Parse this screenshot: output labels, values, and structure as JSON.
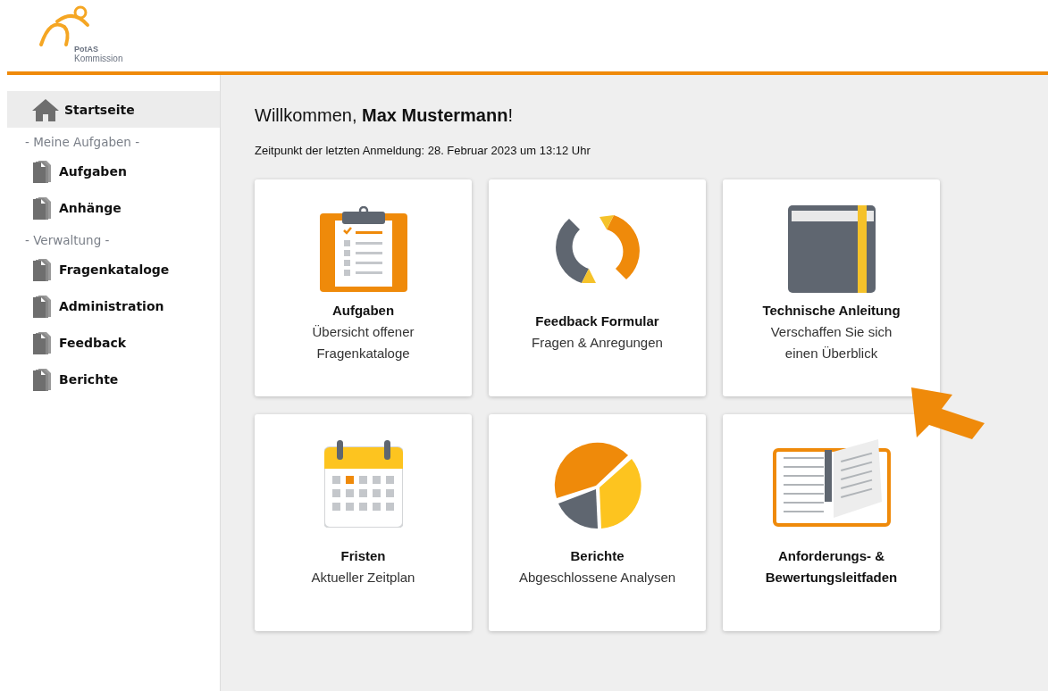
{
  "logo": {
    "name": "PotAS",
    "subtitle": "Kommission"
  },
  "sidebar": {
    "items": [
      {
        "kind": "home",
        "label": "Startseite",
        "selected": true
      },
      {
        "kind": "section",
        "label": "- Meine Aufgaben -"
      },
      {
        "kind": "page",
        "label": "Aufgaben",
        "selected": false
      },
      {
        "kind": "page",
        "label": "Anhänge",
        "selected": false
      },
      {
        "kind": "section",
        "label": "- Verwaltung -"
      },
      {
        "kind": "page",
        "label": "Fragenkataloge",
        "selected": false
      },
      {
        "kind": "page",
        "label": "Administration",
        "selected": false
      },
      {
        "kind": "page",
        "label": "Feedback",
        "selected": false
      },
      {
        "kind": "page",
        "label": "Berichte",
        "selected": false
      }
    ]
  },
  "main": {
    "greeting": "Willkommen, **Max Mustermann**!",
    "last_login": "Zeitpunkt der letzten Anmeldung: 28. Februar 2023 um 13:12 Uhr",
    "tiles": [
      {
        "kind": "clipboard",
        "title": "Aufgaben",
        "subtitle_lines": [
          "Übersicht offener",
          "Fragenkataloge"
        ]
      },
      {
        "kind": "pencils",
        "title": "Feedback Formular",
        "subtitle_lines": [
          "Fragen & Anregungen"
        ]
      },
      {
        "kind": "book",
        "title": "Technische Anleitung",
        "subtitle_lines": [
          "Verschaffen Sie sich",
          "einen Überblick"
        ]
      },
      {
        "kind": "calendar",
        "title": "Fristen",
        "subtitle_lines": [
          "Aktueller Zeitplan"
        ]
      },
      {
        "kind": "pie",
        "title": "Berichte",
        "subtitle_lines": [
          "Abgeschlossene Analysen"
        ]
      },
      {
        "kind": "open-book",
        "title": "Anforderungs- & Bewertungsleitfaden"
      }
    ]
  }
}
